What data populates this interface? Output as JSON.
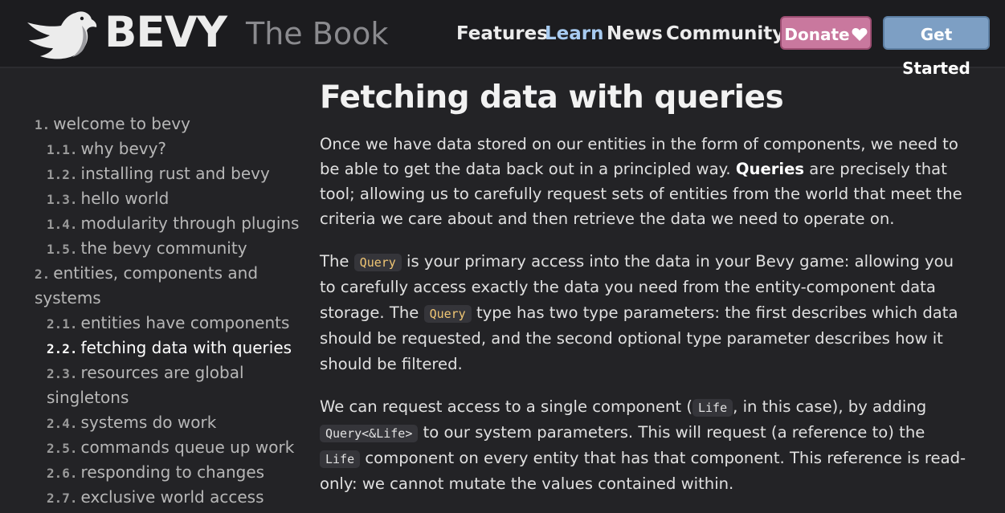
{
  "header": {
    "brand": "BEVY",
    "book_title": "The Book",
    "nav": [
      "Features",
      "Learn",
      "News",
      "Community"
    ],
    "active_nav": "Learn",
    "donate_label": "Donate",
    "get_started_label": "Get Started"
  },
  "sidebar": {
    "items": [
      {
        "num": "1.",
        "label": "welcome to bevy"
      },
      {
        "num": "1.1.",
        "label": "why bevy?"
      },
      {
        "num": "1.2.",
        "label": "installing rust and bevy"
      },
      {
        "num": "1.3.",
        "label": "hello world"
      },
      {
        "num": "1.4.",
        "label": "modularity through plugins"
      },
      {
        "num": "1.5.",
        "label": "the bevy community"
      },
      {
        "num": "2.",
        "label": "entities, components and"
      },
      {
        "num": "",
        "label": "systems"
      },
      {
        "num": "2.1.",
        "label": "entities have components"
      },
      {
        "num": "2.2.",
        "label": "fetching data with queries"
      },
      {
        "num": "2.3.",
        "label": "resources are global"
      },
      {
        "num": "",
        "label": "singletons"
      },
      {
        "num": "2.4.",
        "label": "systems do work"
      },
      {
        "num": "2.5.",
        "label": "commands queue up work"
      },
      {
        "num": "2.6.",
        "label": "responding to changes"
      },
      {
        "num": "2.7.",
        "label": "exclusive world access"
      }
    ]
  },
  "main": {
    "title": "Fetching data with queries",
    "p1": {
      "l1": "Once we have data stored on our entities in the form of components, we need to",
      "l2a": "be able to get the data back out in a principled way. ",
      "l2b": "Queries",
      "l2c": " are precisely that",
      "l3": "tool; allowing us to carefully request sets of entities from the world that meet the",
      "l4": "criteria we care about and then retrieve the data we need to operate on."
    },
    "p2": {
      "l1a": "The ",
      "code": "Query",
      "l1b": " is your primary access into the data in your Bevy game: allowing you",
      "l2": "to carefully access exactly the data you need from the entity-component data",
      "l3a": "storage. The ",
      "l3b": " type has two type parameters: the first describes which data",
      "l4": "should be requested, and the second optional type parameter describes how it",
      "l5": "should be filtered."
    },
    "p3": {
      "l1a": "We can request access to a single component (",
      "code_life": "Life",
      "l1b": ", in this case), by adding",
      "code_query_life": "Query<&Life>",
      "l2b": " to our system parameters. This will request (a reference to) the",
      "l3b": " component on every entity that has that component. This reference is read-",
      "l4": "only: we cannot mutate the values contained within."
    }
  }
}
